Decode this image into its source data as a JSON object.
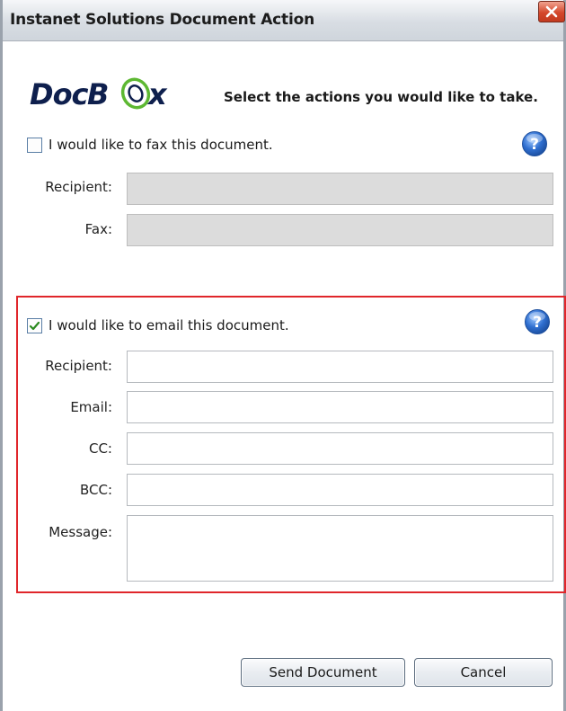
{
  "window": {
    "title": "Instanet Solutions Document Action",
    "close_icon": "close-icon"
  },
  "header": {
    "logo_text": "DocBox",
    "instruction": "Select the actions you would like to take."
  },
  "fax_section": {
    "checkbox_label": "I would like to fax this document.",
    "checked": false,
    "help_icon": "help-icon",
    "fields": {
      "recipient_label": "Recipient:",
      "recipient_value": "",
      "fax_label": "Fax:",
      "fax_value": ""
    }
  },
  "email_section": {
    "checkbox_label": "I would like to email this document.",
    "checked": true,
    "help_icon": "help-icon",
    "fields": {
      "recipient_label": "Recipient:",
      "recipient_value": "",
      "email_label": "Email:",
      "email_value": "",
      "cc_label": "CC:",
      "cc_value": "",
      "bcc_label": "BCC:",
      "bcc_value": "",
      "message_label": "Message:",
      "message_value": ""
    }
  },
  "footer": {
    "send_label": "Send Document",
    "cancel_label": "Cancel"
  },
  "colors": {
    "highlight_border": "#e0262b",
    "help_icon_blue": "#2f6fd0",
    "logo_navy": "#0e1f4d",
    "logo_green": "#5db832"
  }
}
